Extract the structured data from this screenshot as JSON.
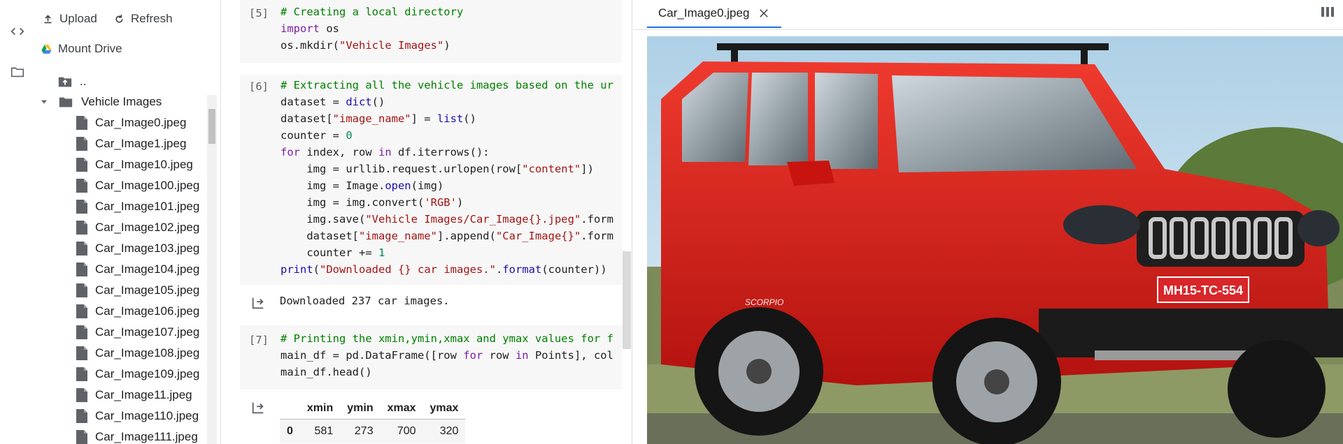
{
  "sidebar": {
    "upload_label": "Upload",
    "refresh_label": "Refresh",
    "mount_drive_label": "Mount Drive",
    "parent_label": "..",
    "folder_label": "Vehicle Images",
    "files": [
      "Car_Image0.jpeg",
      "Car_Image1.jpeg",
      "Car_Image10.jpeg",
      "Car_Image100.jpeg",
      "Car_Image101.jpeg",
      "Car_Image102.jpeg",
      "Car_Image103.jpeg",
      "Car_Image104.jpeg",
      "Car_Image105.jpeg",
      "Car_Image106.jpeg",
      "Car_Image107.jpeg",
      "Car_Image108.jpeg",
      "Car_Image109.jpeg",
      "Car_Image11.jpeg",
      "Car_Image110.jpeg",
      "Car_Image111.jpeg"
    ]
  },
  "notebook": {
    "cells": [
      {
        "number": "[5]",
        "lines": [
          "# Creating a local directory",
          "import os",
          "os.mkdir(\"Vehicle Images\")"
        ]
      },
      {
        "number": "[6]",
        "lines": [
          "# Extracting all the vehicle images based on the ur",
          "dataset = dict()",
          "dataset[\"image_name\"] = list()",
          "counter = 0",
          "for index, row in df.iterrows():",
          "    img = urllib.request.urlopen(row[\"content\"])",
          "    img = Image.open(img)",
          "    img = img.convert('RGB')",
          "    img.save(\"Vehicle Images/Car_Image{}.jpeg\".form",
          "    dataset[\"image_name\"].append(\"Car_Image{}\".form",
          "    counter += 1",
          "print(\"Downloaded {} car images.\".format(counter))"
        ],
        "output": "Downloaded 237 car images."
      },
      {
        "number": "[7]",
        "lines": [
          "# Printing the xmin,ymin,xmax and ymax values for f",
          "main_df = pd.DataFrame([row for row in Points], col",
          "main_df.head()"
        ]
      }
    ],
    "table": {
      "columns": [
        "xmin",
        "ymin",
        "xmax",
        "ymax"
      ],
      "rows": [
        {
          "index": "0",
          "values": [
            "581",
            "273",
            "700",
            "320"
          ]
        }
      ]
    }
  },
  "viewer": {
    "tab_title": "Car_Image0.jpeg",
    "license_plate": "MH15-TC-554",
    "badge_text": "SCORPIO"
  },
  "colors": {
    "accent": "#1a73e8",
    "car_red": "#d91c1c",
    "sky": "#aed0e6",
    "plate": "#d8262a"
  },
  "icons": {
    "rail": [
      "code-icon",
      "folder-icon"
    ],
    "upload": "upload-icon",
    "refresh": "refresh-icon",
    "drive": "google-drive-icon",
    "tab_close": "close-icon",
    "layout": "split-layout-icon",
    "output": "output-arrow-icon"
  }
}
